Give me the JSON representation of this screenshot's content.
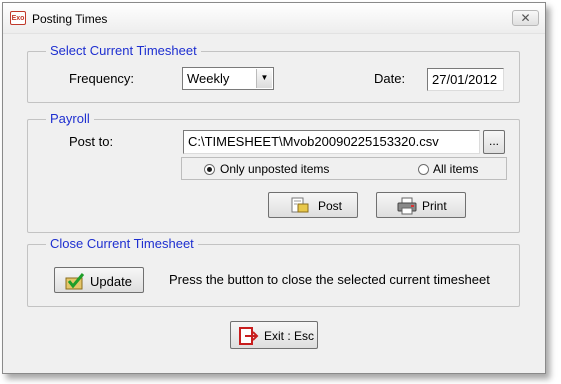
{
  "window": {
    "title": "Posting Times",
    "app_icon_text": "Exo",
    "close_glyph": "✕"
  },
  "select_timesheet": {
    "group_title": "Select Current Timesheet",
    "frequency_label": "Frequency:",
    "frequency_value": "Weekly",
    "date_label": "Date:",
    "date_value": "27/01/2012"
  },
  "payroll": {
    "group_title": "Payroll",
    "post_to_label": "Post to:",
    "post_to_value": "C:\\TIMESHEET\\Mvob20090225153320.csv",
    "browse_label": "...",
    "radio_unposted": "Only unposted items",
    "radio_all": "All items",
    "selected_option": "unposted",
    "post_button": "Post",
    "print_button": "Print"
  },
  "close_timesheet": {
    "group_title": "Close Current Timesheet",
    "update_button": "Update",
    "description": "Press the button to close the selected current timesheet"
  },
  "exit_button": "Exit : Esc"
}
